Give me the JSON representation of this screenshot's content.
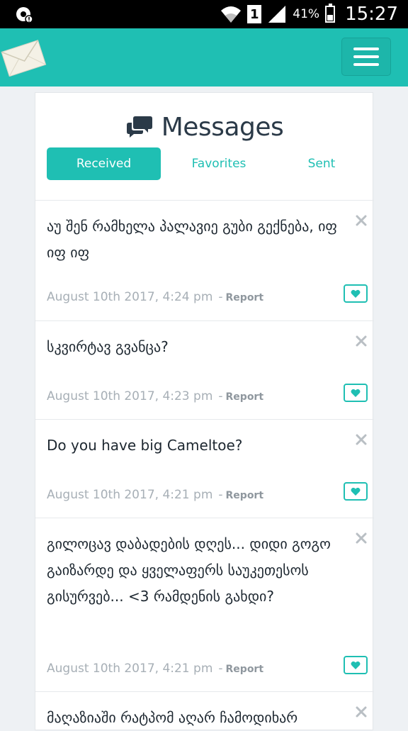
{
  "status_bar": {
    "battery_percent": "41%",
    "sim_slot": "1",
    "time": "15:27",
    "icons": [
      "notification-icon",
      "wifi-icon",
      "sim-icon",
      "signal-icon",
      "battery-icon"
    ]
  },
  "header": {
    "logo_icon": "envelope-icon",
    "menu_icon": "hamburger-icon",
    "brand_color": "#1fbfb3"
  },
  "page": {
    "title": "Messages",
    "title_icon": "chat-bubbles-icon"
  },
  "tabs": [
    {
      "label": "Received",
      "active": true
    },
    {
      "label": "Favorites",
      "active": false
    },
    {
      "label": "Sent",
      "active": false
    }
  ],
  "messages": [
    {
      "text": "აუ შენ რამხელა პალავიე გუბი გექნება, იფ იფ იფ",
      "date": "August 10th 2017, 4:24 pm",
      "sep": "-",
      "report": "Report"
    },
    {
      "text": "სკვირტავ გვანცა?",
      "date": "August 10th 2017, 4:23 pm",
      "sep": "-",
      "report": "Report"
    },
    {
      "text": "Do you have big Cameltoe?",
      "date": "August 10th 2017, 4:21 pm",
      "sep": "-",
      "report": "Report"
    },
    {
      "text": "გილოცავ დაბადების დღეს... დიდი გოგო გაიზარდე და ყველაფერს საუკეთესოს გისურვებ... <3 რამდენის გახდი?",
      "date": "August 10th 2017, 4:21 pm",
      "sep": "-",
      "report": "Report"
    },
    {
      "text": "მაღაზიაში რატპომ აღარ ჩამოდიხარ",
      "date": "",
      "sep": "",
      "report": ""
    }
  ]
}
